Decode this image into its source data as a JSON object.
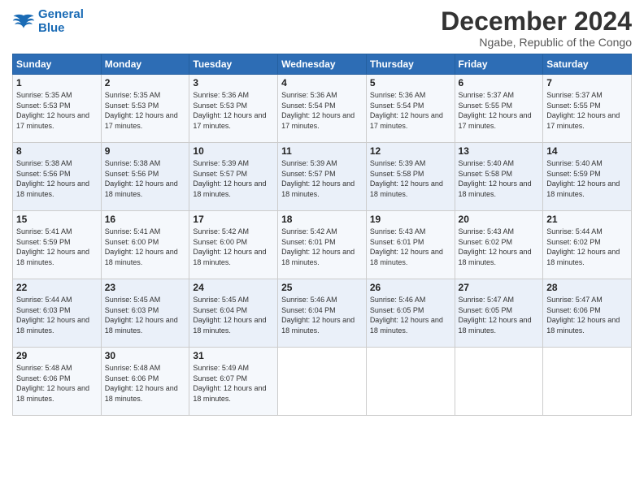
{
  "logo": {
    "line1": "General",
    "line2": "Blue"
  },
  "title": "December 2024",
  "subtitle": "Ngabe, Republic of the Congo",
  "weekdays": [
    "Sunday",
    "Monday",
    "Tuesday",
    "Wednesday",
    "Thursday",
    "Friday",
    "Saturday"
  ],
  "weeks": [
    [
      {
        "day": "1",
        "sunrise": "5:35 AM",
        "sunset": "5:53 PM",
        "daylight": "12 hours and 17 minutes."
      },
      {
        "day": "2",
        "sunrise": "5:35 AM",
        "sunset": "5:53 PM",
        "daylight": "12 hours and 17 minutes."
      },
      {
        "day": "3",
        "sunrise": "5:36 AM",
        "sunset": "5:53 PM",
        "daylight": "12 hours and 17 minutes."
      },
      {
        "day": "4",
        "sunrise": "5:36 AM",
        "sunset": "5:54 PM",
        "daylight": "12 hours and 17 minutes."
      },
      {
        "day": "5",
        "sunrise": "5:36 AM",
        "sunset": "5:54 PM",
        "daylight": "12 hours and 17 minutes."
      },
      {
        "day": "6",
        "sunrise": "5:37 AM",
        "sunset": "5:55 PM",
        "daylight": "12 hours and 17 minutes."
      },
      {
        "day": "7",
        "sunrise": "5:37 AM",
        "sunset": "5:55 PM",
        "daylight": "12 hours and 17 minutes."
      }
    ],
    [
      {
        "day": "8",
        "sunrise": "5:38 AM",
        "sunset": "5:56 PM",
        "daylight": "12 hours and 18 minutes."
      },
      {
        "day": "9",
        "sunrise": "5:38 AM",
        "sunset": "5:56 PM",
        "daylight": "12 hours and 18 minutes."
      },
      {
        "day": "10",
        "sunrise": "5:39 AM",
        "sunset": "5:57 PM",
        "daylight": "12 hours and 18 minutes."
      },
      {
        "day": "11",
        "sunrise": "5:39 AM",
        "sunset": "5:57 PM",
        "daylight": "12 hours and 18 minutes."
      },
      {
        "day": "12",
        "sunrise": "5:39 AM",
        "sunset": "5:58 PM",
        "daylight": "12 hours and 18 minutes."
      },
      {
        "day": "13",
        "sunrise": "5:40 AM",
        "sunset": "5:58 PM",
        "daylight": "12 hours and 18 minutes."
      },
      {
        "day": "14",
        "sunrise": "5:40 AM",
        "sunset": "5:59 PM",
        "daylight": "12 hours and 18 minutes."
      }
    ],
    [
      {
        "day": "15",
        "sunrise": "5:41 AM",
        "sunset": "5:59 PM",
        "daylight": "12 hours and 18 minutes."
      },
      {
        "day": "16",
        "sunrise": "5:41 AM",
        "sunset": "6:00 PM",
        "daylight": "12 hours and 18 minutes."
      },
      {
        "day": "17",
        "sunrise": "5:42 AM",
        "sunset": "6:00 PM",
        "daylight": "12 hours and 18 minutes."
      },
      {
        "day": "18",
        "sunrise": "5:42 AM",
        "sunset": "6:01 PM",
        "daylight": "12 hours and 18 minutes."
      },
      {
        "day": "19",
        "sunrise": "5:43 AM",
        "sunset": "6:01 PM",
        "daylight": "12 hours and 18 minutes."
      },
      {
        "day": "20",
        "sunrise": "5:43 AM",
        "sunset": "6:02 PM",
        "daylight": "12 hours and 18 minutes."
      },
      {
        "day": "21",
        "sunrise": "5:44 AM",
        "sunset": "6:02 PM",
        "daylight": "12 hours and 18 minutes."
      }
    ],
    [
      {
        "day": "22",
        "sunrise": "5:44 AM",
        "sunset": "6:03 PM",
        "daylight": "12 hours and 18 minutes."
      },
      {
        "day": "23",
        "sunrise": "5:45 AM",
        "sunset": "6:03 PM",
        "daylight": "12 hours and 18 minutes."
      },
      {
        "day": "24",
        "sunrise": "5:45 AM",
        "sunset": "6:04 PM",
        "daylight": "12 hours and 18 minutes."
      },
      {
        "day": "25",
        "sunrise": "5:46 AM",
        "sunset": "6:04 PM",
        "daylight": "12 hours and 18 minutes."
      },
      {
        "day": "26",
        "sunrise": "5:46 AM",
        "sunset": "6:05 PM",
        "daylight": "12 hours and 18 minutes."
      },
      {
        "day": "27",
        "sunrise": "5:47 AM",
        "sunset": "6:05 PM",
        "daylight": "12 hours and 18 minutes."
      },
      {
        "day": "28",
        "sunrise": "5:47 AM",
        "sunset": "6:06 PM",
        "daylight": "12 hours and 18 minutes."
      }
    ],
    [
      {
        "day": "29",
        "sunrise": "5:48 AM",
        "sunset": "6:06 PM",
        "daylight": "12 hours and 18 minutes."
      },
      {
        "day": "30",
        "sunrise": "5:48 AM",
        "sunset": "6:06 PM",
        "daylight": "12 hours and 18 minutes."
      },
      {
        "day": "31",
        "sunrise": "5:49 AM",
        "sunset": "6:07 PM",
        "daylight": "12 hours and 18 minutes."
      },
      null,
      null,
      null,
      null
    ]
  ]
}
